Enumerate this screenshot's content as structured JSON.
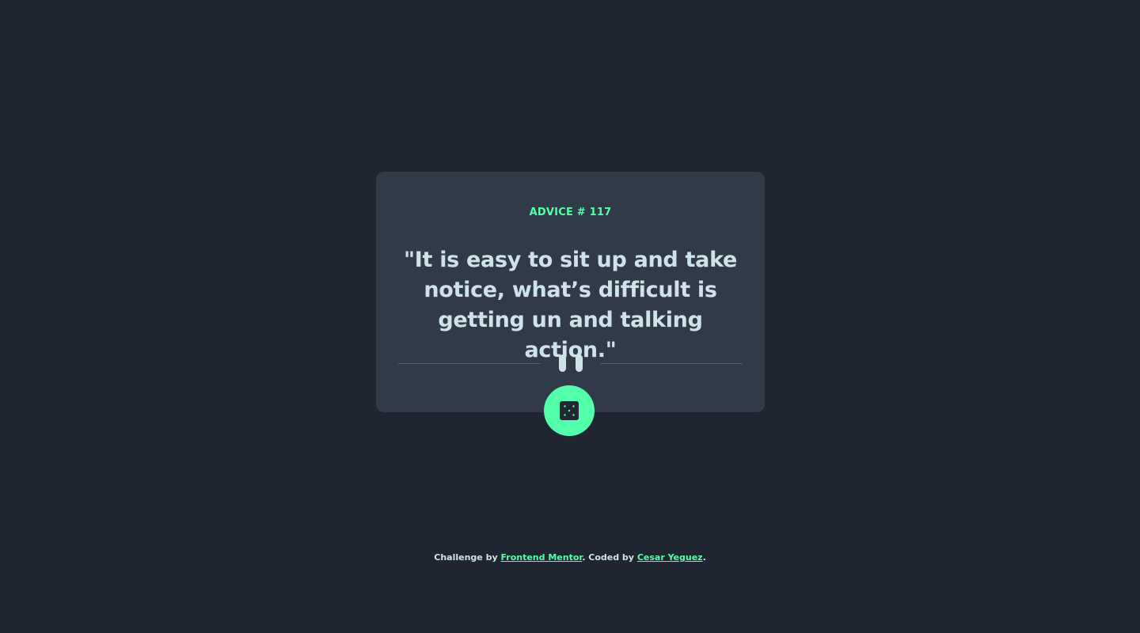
{
  "advice": {
    "id_label": "ADVICE # 117",
    "quote": "\"It is easy to sit up and take notice, what’s difficult is getting un and talking action.\""
  },
  "button": {
    "icon": "dice-icon",
    "accent_color": "#53FFAA"
  },
  "attribution": {
    "prefix": "Challenge by ",
    "challenge_link": "Frontend Mentor",
    "middle": ". Coded by ",
    "author_link": "Cesar Yeguez",
    "suffix": "."
  },
  "colors": {
    "background": "#1F2632",
    "card": "#313A48",
    "accent": "#53FFAA",
    "text": "#CEE3E9",
    "divider": "#4F5D74"
  }
}
